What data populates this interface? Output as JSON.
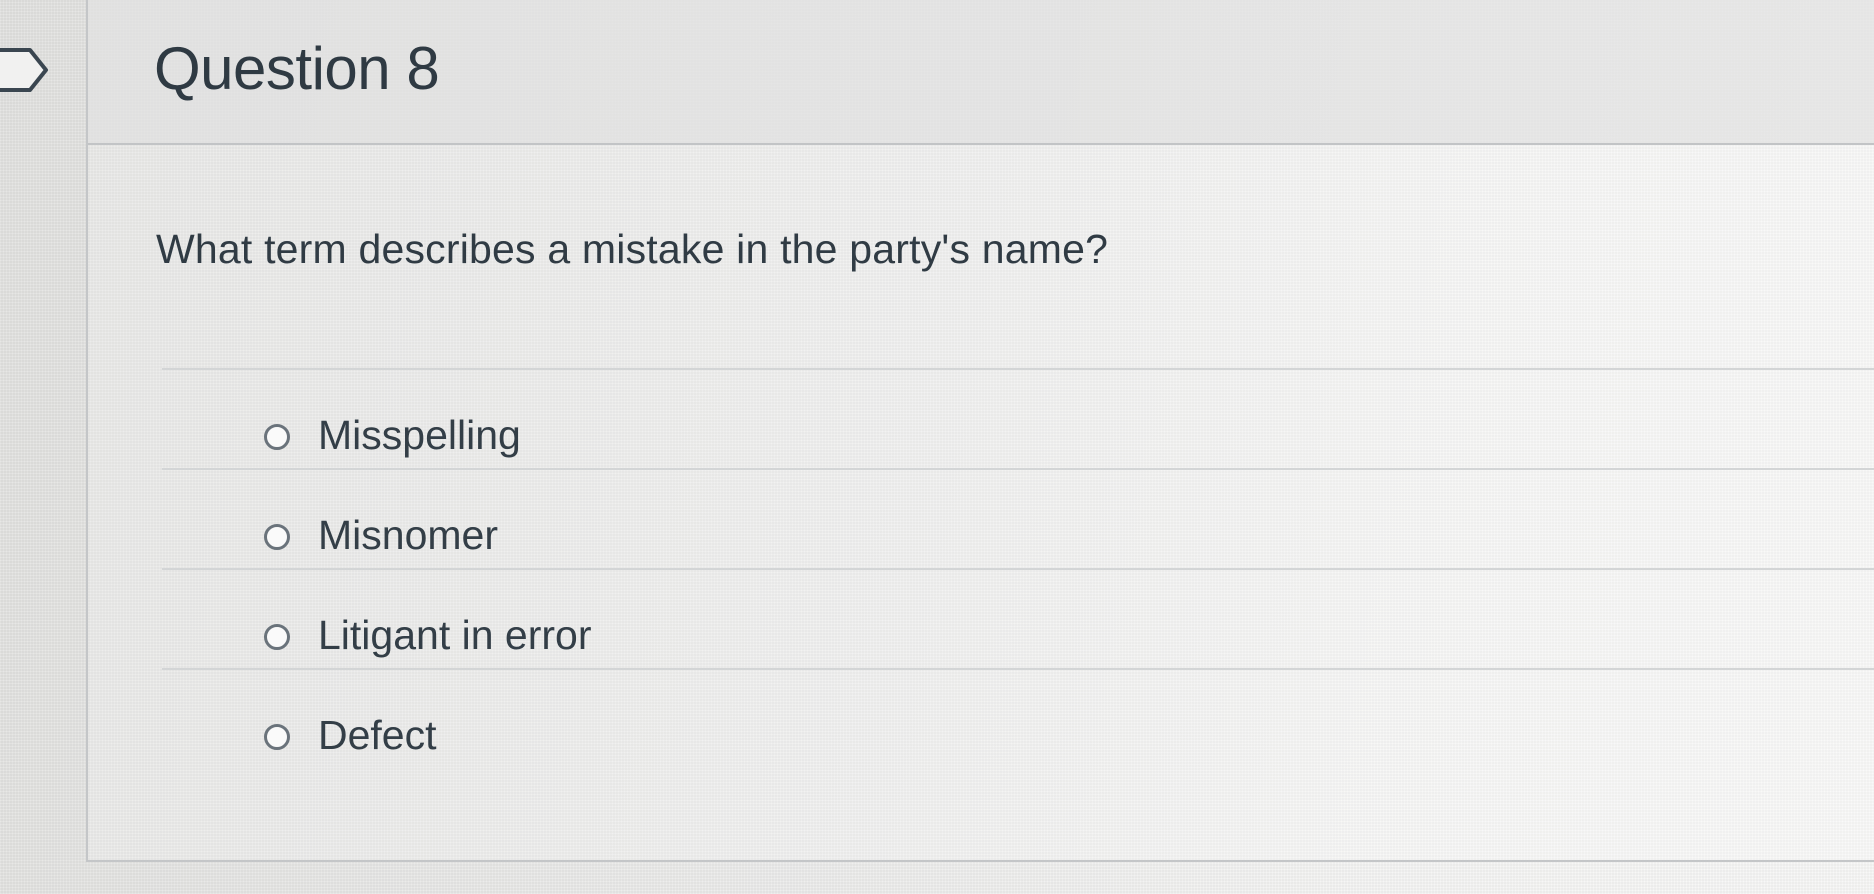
{
  "question": {
    "title": "Question 8",
    "text": "What term describes a mistake in the party's name?"
  },
  "answers": [
    {
      "label": "Misspelling",
      "selected": false
    },
    {
      "label": "Misnomer",
      "selected": false
    },
    {
      "label": "Litigant in error",
      "selected": false
    },
    {
      "label": "Defect",
      "selected": false
    }
  ],
  "icons": {
    "flag": "flag-marker-icon",
    "radio": "radio-unchecked-icon"
  }
}
